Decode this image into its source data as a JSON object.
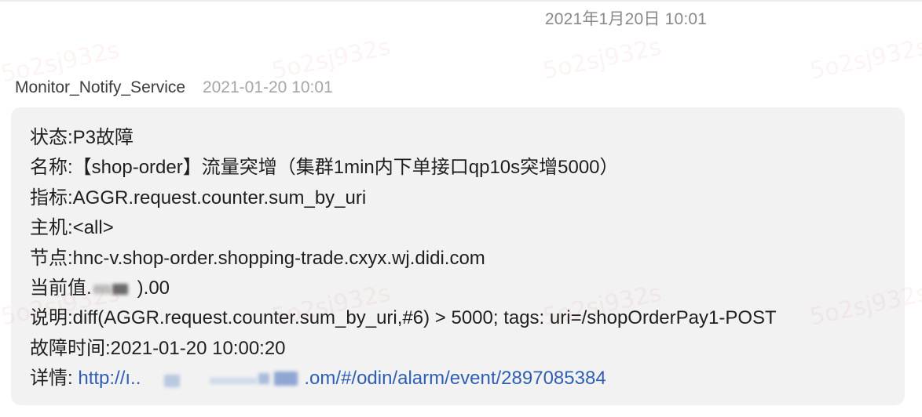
{
  "chat": {
    "date_header": "2021年1月20日 10:01",
    "sender": {
      "name": "Monitor_Notify_Service",
      "time": "2021-01-20 10:01"
    },
    "watermark_text": "5o2sj932s",
    "message": {
      "status_label": "状态:",
      "status_value": "P3故障",
      "name_label": "名称:",
      "name_value": "【shop-order】流量突增（集群1min内下单接口qp10s突增5000）",
      "metric_label": "指标:",
      "metric_value": "AGGR.request.counter.sum_by_uri",
      "host_label": "主机:",
      "host_value": "<all>",
      "node_label": "节点:",
      "node_value": "hnc-v.shop-order.shopping-trade.cxyx.wj.didi.com",
      "current_label": "当前值.",
      "current_value_visible": ").00",
      "desc_label": "说明:",
      "desc_value": "diff(AGGR.request.counter.sum_by_uri,#6) > 5000; tags: uri=/shopOrderPay1-POST",
      "fault_time_label": "故障时间:",
      "fault_time_value": "2021-01-20 10:00:20",
      "detail_label": "详情:",
      "detail_link_start": "http://ı..",
      "detail_link_end": ".om/#/odin/alarm/event/2897085384"
    }
  }
}
